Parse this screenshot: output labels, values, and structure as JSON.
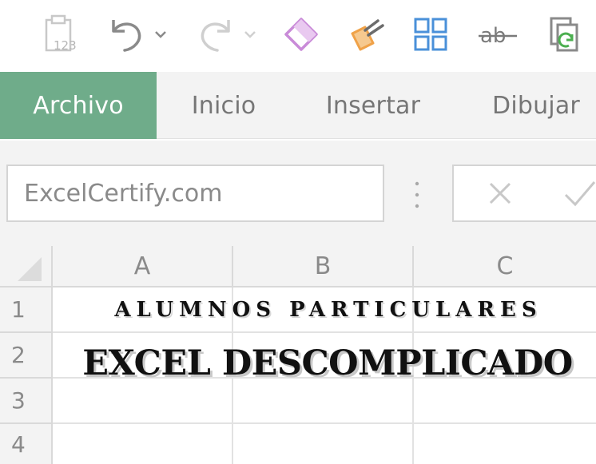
{
  "toolbar": {
    "icons": [
      "paste-values-icon",
      "undo-icon",
      "undo-dropdown-icon",
      "redo-icon",
      "redo-dropdown-icon",
      "eraser-icon",
      "format-painter-icon",
      "grid-view-icon",
      "strikethrough-icon",
      "refresh-copy-icon"
    ],
    "paste_label": "123",
    "strike_label": "ab"
  },
  "tabs": [
    {
      "label": "Archivo",
      "active": true
    },
    {
      "label": "Inicio",
      "active": false
    },
    {
      "label": "Insertar",
      "active": false
    },
    {
      "label": "Dibujar",
      "active": false
    }
  ],
  "namebox": {
    "value": "ExcelCertify.com"
  },
  "grid": {
    "columns": [
      "A",
      "B",
      "C"
    ],
    "rows": [
      "1",
      "2",
      "3",
      "4"
    ],
    "row1_text": "ALUMNOS PARTICULARES",
    "row2_text": "EXCEL DESCOMPLICADO"
  },
  "colors": {
    "active_tab": "#6fac8a",
    "eraser": "#c98bd8",
    "painter": "#f0a248",
    "grid_icon": "#4a90d9",
    "refresh": "#4caf50"
  }
}
